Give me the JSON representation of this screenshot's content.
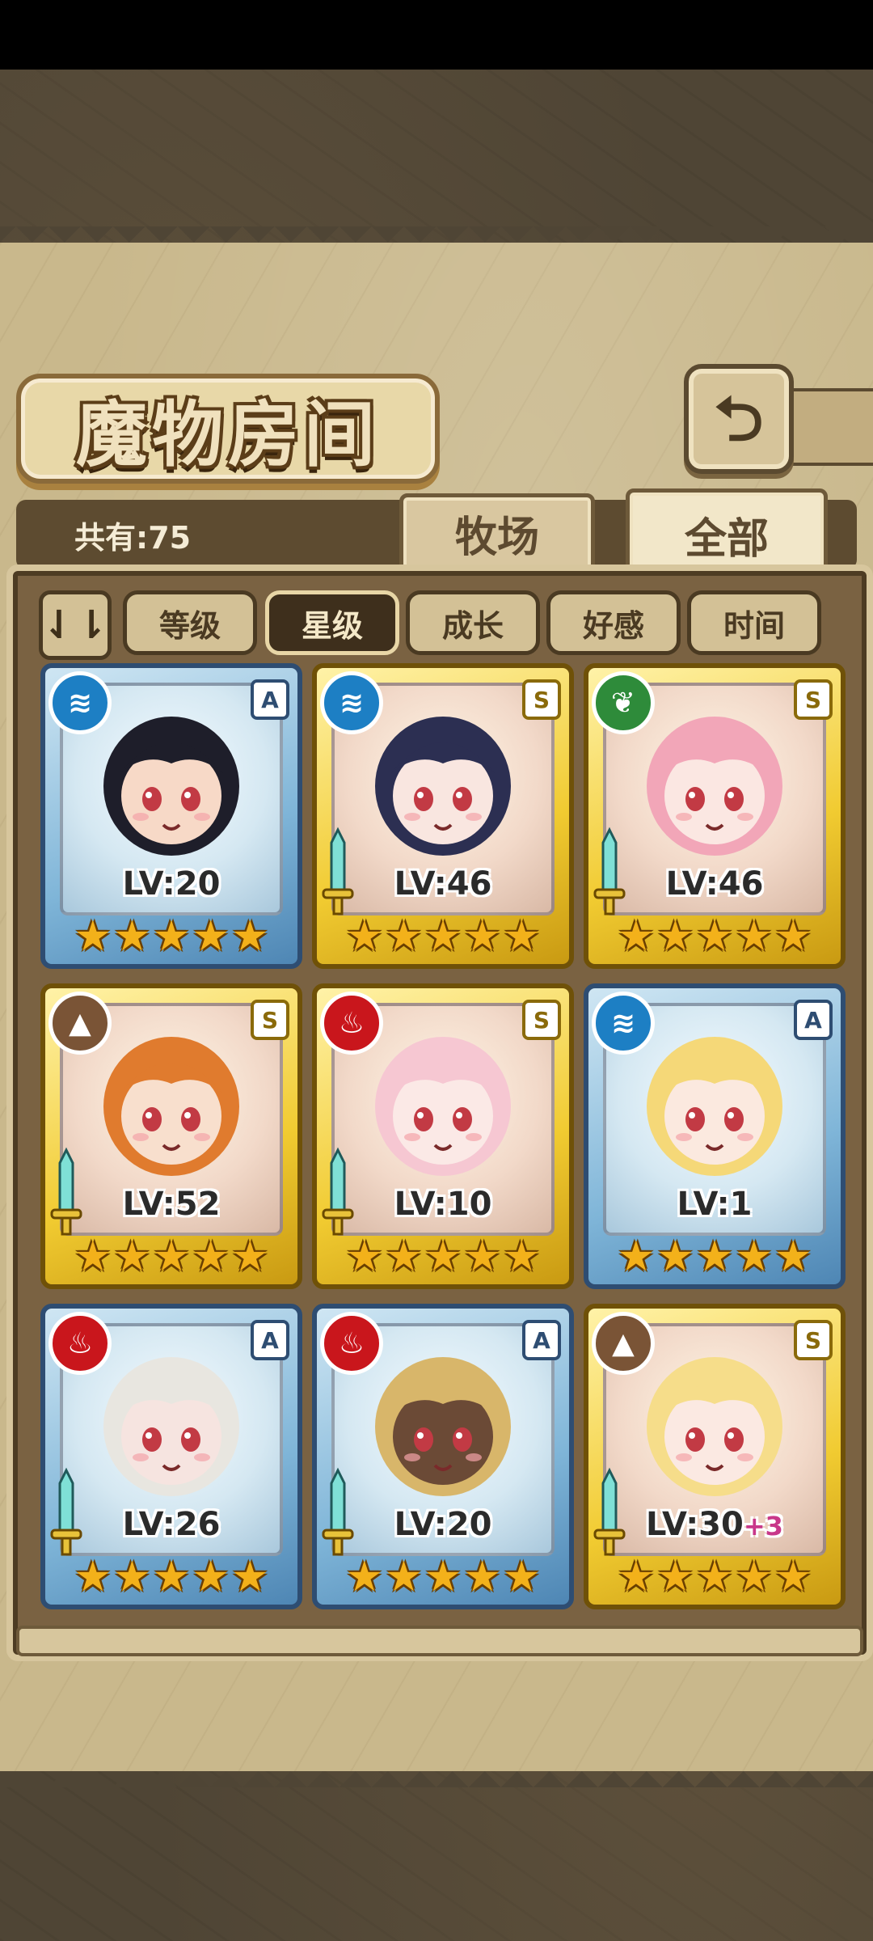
{
  "title": "魔物房间",
  "total_count": "共有:75",
  "tabs": {
    "ranch": "牧场",
    "all": "全部"
  },
  "sort": {
    "toggle_icon": "sort-order-icon",
    "buttons": [
      "等级",
      "星级",
      "成长",
      "好感",
      "时间"
    ],
    "active": "星级"
  },
  "cards": [
    {
      "level": "LV:20",
      "bonus": "",
      "rank": "A",
      "element": "water",
      "stars": 5,
      "weapon": false,
      "hair": "#1e1e2a",
      "skin": "#f7d9c7"
    },
    {
      "level": "LV:46",
      "bonus": "",
      "rank": "S",
      "element": "water",
      "stars": 5,
      "weapon": true,
      "hair": "#2c2f52",
      "skin": "#f9e6e0"
    },
    {
      "level": "LV:46",
      "bonus": "",
      "rank": "S",
      "element": "nature",
      "stars": 5,
      "weapon": true,
      "hair": "#f2a6b8",
      "skin": "#fbe7e2"
    },
    {
      "level": "LV:52",
      "bonus": "",
      "rank": "S",
      "element": "earth",
      "stars": 5,
      "weapon": true,
      "hair": "#e07b2e",
      "skin": "#f8dfcd"
    },
    {
      "level": "LV:10",
      "bonus": "",
      "rank": "S",
      "element": "fire",
      "stars": 5,
      "weapon": true,
      "hair": "#f6c7d2",
      "skin": "#fbe9e6"
    },
    {
      "level": "LV:1",
      "bonus": "",
      "rank": "A",
      "element": "water",
      "stars": 5,
      "weapon": false,
      "hair": "#f5d878",
      "skin": "#fbe9df"
    },
    {
      "level": "LV:26",
      "bonus": "",
      "rank": "A",
      "element": "fire",
      "stars": 5,
      "weapon": true,
      "hair": "#e8e6e0",
      "skin": "#f6e4e0"
    },
    {
      "level": "LV:20",
      "bonus": "",
      "rank": "A",
      "element": "fire",
      "stars": 5,
      "weapon": true,
      "hair": "#d8b66a",
      "skin": "#6b4a36"
    },
    {
      "level": "LV:30",
      "bonus": "+3",
      "rank": "S",
      "element": "earth",
      "stars": 5,
      "weapon": true,
      "hair": "#f6dd8a",
      "skin": "#fbe9e2"
    }
  ]
}
